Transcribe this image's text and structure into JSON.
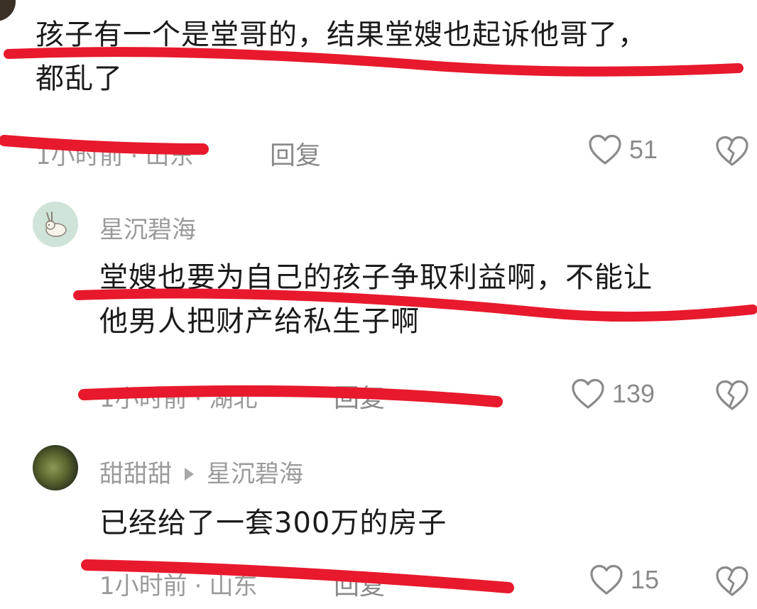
{
  "comments": [
    {
      "text_line1": "孩子有一个是堂哥的，结果堂嫂也起诉他哥了，",
      "text_line2": "都乱了",
      "time": "1小时前",
      "location": "山东",
      "reply_label": "回复",
      "likes": "51"
    },
    {
      "username": "星沉碧海",
      "text_line1": "堂嫂也要为自己的孩子争取利益啊，不能让",
      "text_line2": "他男人把财产给私生子啊",
      "time": "1小时前",
      "location": "湖北",
      "reply_label": "回复",
      "likes": "139"
    },
    {
      "username": "甜甜甜",
      "reply_to": "星沉碧海",
      "text_line1": "已经给了一套300万的房子",
      "time": "1小时前",
      "location": "山东",
      "reply_label": "回复",
      "likes": "15"
    }
  ],
  "icons": {
    "like": "heart-outline-icon",
    "dislike": "broken-heart-icon"
  },
  "colors": {
    "scribble": "#e8192c",
    "meta_text": "#9a9a9a",
    "body_text": "#1a1a1a"
  }
}
